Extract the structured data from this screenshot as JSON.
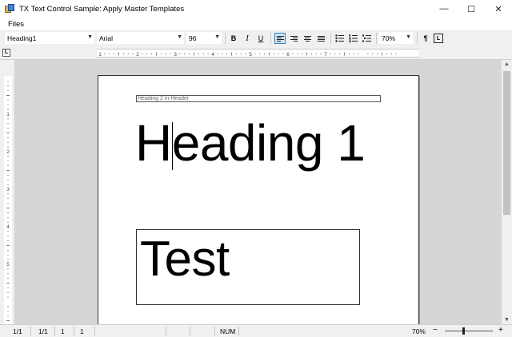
{
  "window": {
    "title": "TX Text Control Sample: Apply Master Templates",
    "minimize_glyph": "—",
    "maximize_glyph": "☐",
    "close_glyph": "✕"
  },
  "menu": {
    "files": "Files"
  },
  "toolbar": {
    "style_value": "Heading1",
    "font_value": "Arial",
    "size_value": "96",
    "bold": "B",
    "italic": "I",
    "underline": "U",
    "zoom_value": "70%",
    "pilcrow": "¶",
    "frame_glyph": "L"
  },
  "ruler": {
    "corner": "L",
    "hticks": [
      "1",
      "2",
      "3",
      "4",
      "5",
      "6",
      "7"
    ],
    "vticks": [
      "1",
      "2",
      "3",
      "4",
      "5"
    ]
  },
  "document": {
    "header_text": "Heading 2 in Header",
    "heading1": "Heading 1",
    "frame_text": "Test"
  },
  "status": {
    "page": "1/1",
    "section": "1/1",
    "line": "1",
    "column": "1",
    "num": "NUM",
    "zoom": "70%",
    "zoom_minus": "−",
    "zoom_plus": "+"
  }
}
